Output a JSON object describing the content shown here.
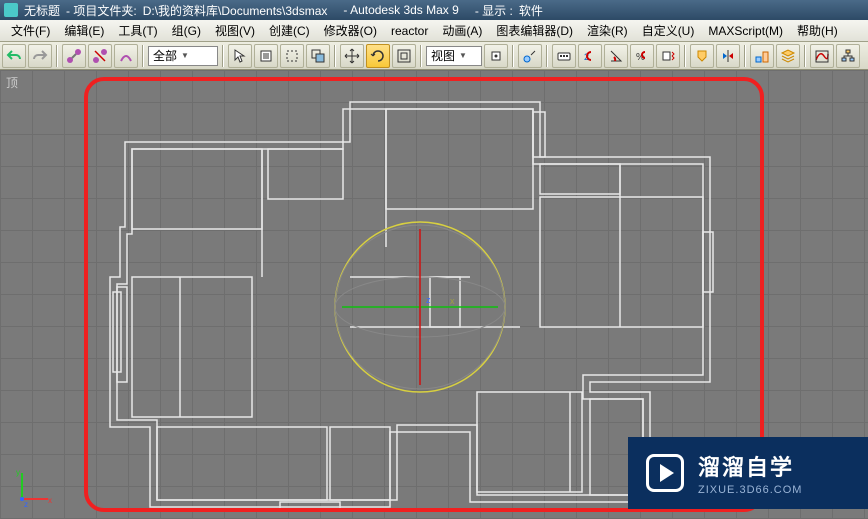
{
  "title": {
    "untitled": "无标题",
    "project_label": "- 项目文件夹:",
    "project_path": "D:\\我的资料库\\Documents\\3dsmax",
    "app": "- Autodesk 3ds Max 9",
    "display_label": "- 显示 :",
    "display_value": "软件"
  },
  "menu": {
    "file": "文件(F)",
    "edit": "编辑(E)",
    "tools": "工具(T)",
    "group": "组(G)",
    "views": "视图(V)",
    "create": "创建(C)",
    "modifiers": "修改器(O)",
    "reactor": "reactor",
    "animation": "动画(A)",
    "graph": "图表编辑器(D)",
    "render": "渲染(R)",
    "customize": "自定义(U)",
    "maxscript": "MAXScript(M)",
    "help": "帮助(H)"
  },
  "toolbar": {
    "selection_set": "全部",
    "view_combo": "视图"
  },
  "viewport": {
    "label": "顶",
    "axis": {
      "x": "x",
      "y": "y",
      "z": "z"
    }
  },
  "watermark": {
    "brand": "溜溜自学",
    "url": "ZIXUE.3D66.COM"
  },
  "colors": {
    "highlight_border": "#f02020",
    "watermark_bg": "#0b2f5e"
  }
}
